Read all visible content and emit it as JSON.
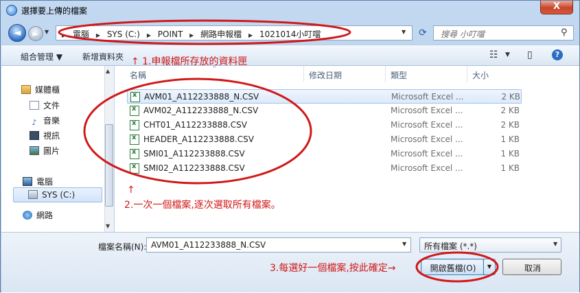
{
  "window": {
    "title": "選擇要上傳的檔案",
    "close": "X"
  },
  "nav": {
    "back": "◄",
    "forward": "►",
    "breadcrumbs": [
      "電腦",
      "SYS (C:)",
      "POINT",
      "網路申報檔",
      "1021014小叮噹"
    ],
    "search_placeholder": "搜尋 小叮噹"
  },
  "toolbar": {
    "organize": "組合管理 ▼",
    "new_folder": "新增資料夾"
  },
  "annotations": {
    "a1": "↑ 1.申報檔所存放的資料匣",
    "a2_arrow": "↑",
    "a2": "2.一次一個檔案,逐次選取所有檔案。",
    "a3": "3.每選好一個檔案,按此確定→"
  },
  "sidebar": {
    "items": [
      {
        "label": "媒體櫃",
        "icon": "library-icon"
      },
      {
        "label": "文件",
        "icon": "documents-icon"
      },
      {
        "label": "音樂",
        "icon": "music-icon"
      },
      {
        "label": "視訊",
        "icon": "video-icon"
      },
      {
        "label": "圖片",
        "icon": "pictures-icon"
      },
      {
        "label": "電腦",
        "icon": "computer-icon"
      },
      {
        "label": "SYS (C:)",
        "icon": "drive-icon"
      },
      {
        "label": "網路",
        "icon": "network-icon"
      }
    ]
  },
  "columns": {
    "name": "名稱",
    "modified": "修改日期",
    "type": "類型",
    "size": "大小"
  },
  "files": [
    {
      "name": "AVM01_A112233888_N.CSV",
      "type": "Microsoft Excel ...",
      "size": "2 KB"
    },
    {
      "name": "AVM02_A112233888_N.CSV",
      "type": "Microsoft Excel ...",
      "size": "2 KB"
    },
    {
      "name": "CHT01_A112233888.CSV",
      "type": "Microsoft Excel ...",
      "size": "2 KB"
    },
    {
      "name": "HEADER_A112233888.CSV",
      "type": "Microsoft Excel ...",
      "size": "1 KB"
    },
    {
      "name": "SMI01_A112233888.CSV",
      "type": "Microsoft Excel ...",
      "size": "1 KB"
    },
    {
      "name": "SMI02_A112233888.CSV",
      "type": "Microsoft Excel ...",
      "size": "1 KB"
    }
  ],
  "bottom": {
    "filename_label": "檔案名稱(N):",
    "filename_value": "AVM01_A112233888_N.CSV",
    "filetype_value": "所有檔案 (*.*)",
    "open_label": "開啟舊檔(O)",
    "cancel_label": "取消"
  }
}
